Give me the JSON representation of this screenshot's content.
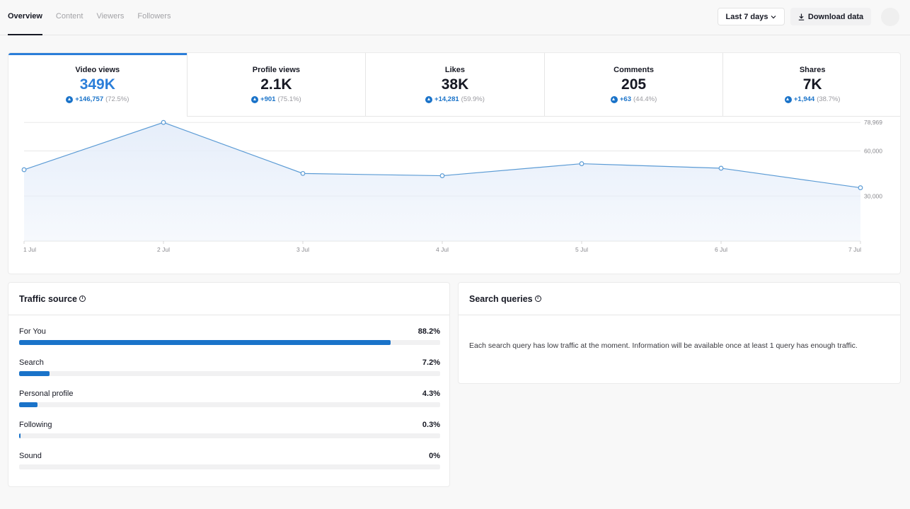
{
  "tabs": [
    {
      "label": "Overview",
      "active": true
    },
    {
      "label": "Content",
      "active": false
    },
    {
      "label": "Viewers",
      "active": false
    },
    {
      "label": "Followers",
      "active": false
    }
  ],
  "toolbar": {
    "date_range": "Last 7 days",
    "download_label": "Download data"
  },
  "metrics": [
    {
      "label": "Video views",
      "value": "349K",
      "delta": "+146,757",
      "pct": "(72.5%)"
    },
    {
      "label": "Profile views",
      "value": "2.1K",
      "delta": "+901",
      "pct": "(75.1%)"
    },
    {
      "label": "Likes",
      "value": "38K",
      "delta": "+14,281",
      "pct": "(59.9%)"
    },
    {
      "label": "Comments",
      "value": "205",
      "delta": "+63",
      "pct": "(44.4%)"
    },
    {
      "label": "Shares",
      "value": "7K",
      "delta": "+1,944",
      "pct": "(38.7%)"
    }
  ],
  "chart_data": {
    "type": "area",
    "x": [
      "1 Jul",
      "2 Jul",
      "3 Jul",
      "4 Jul",
      "5 Jul",
      "6 Jul",
      "7 Jul"
    ],
    "series": [
      {
        "values": [
          47500,
          78969,
          45000,
          43500,
          51500,
          48500,
          35500
        ]
      }
    ],
    "y_ticks": [
      {
        "value": 78969,
        "label": "78,969"
      },
      {
        "value": 60000,
        "label": "60,000"
      },
      {
        "value": 30000,
        "label": "30,000"
      }
    ],
    "ylim": [
      0,
      80000
    ],
    "grid": true,
    "colors": {
      "line": "#5b9bd5",
      "fill": "#e6eefa"
    }
  },
  "traffic": {
    "title": "Traffic source",
    "items": [
      {
        "label": "For You",
        "value": "88.2%",
        "fraction": 0.882
      },
      {
        "label": "Search",
        "value": "7.2%",
        "fraction": 0.072
      },
      {
        "label": "Personal profile",
        "value": "4.3%",
        "fraction": 0.043
      },
      {
        "label": "Following",
        "value": "0.3%",
        "fraction": 0.003
      },
      {
        "label": "Sound",
        "value": "0%",
        "fraction": 0
      }
    ]
  },
  "search": {
    "title": "Search queries",
    "message": "Each search query has low traffic at the moment. Information will be available once at least 1 query has enough traffic."
  },
  "icons": {
    "info": "info-icon",
    "download": "download-icon",
    "chevron": "chevron-down-icon",
    "increase": "arrow-up-icon"
  }
}
